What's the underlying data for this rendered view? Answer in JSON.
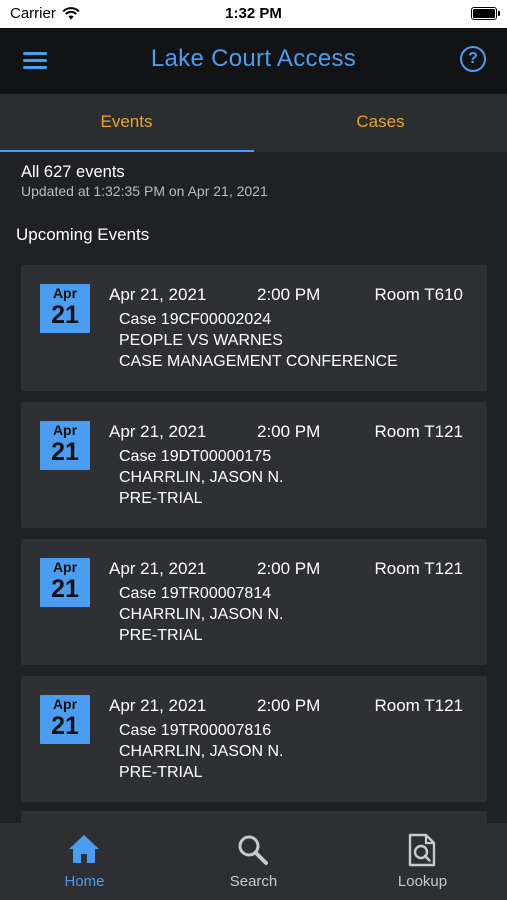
{
  "status_bar": {
    "carrier": "Carrier",
    "time": "1:32 PM"
  },
  "header": {
    "title": "Lake Court Access"
  },
  "tabs": [
    {
      "label": "Events",
      "selected": true
    },
    {
      "label": "Cases",
      "selected": false
    }
  ],
  "summary": {
    "count": "All 627 events",
    "updated": "Updated at 1:32:35 PM on Apr 21, 2021"
  },
  "section_title": "Upcoming Events",
  "events": [
    {
      "month": "Apr",
      "day": "21",
      "date": "Apr 21, 2021",
      "time": "2:00 PM",
      "room": "Room T610",
      "case": "Case 19CF00002024",
      "party": "PEOPLE VS WARNES",
      "type": "CASE MANAGEMENT CONFERENCE"
    },
    {
      "month": "Apr",
      "day": "21",
      "date": "Apr 21, 2021",
      "time": "2:00 PM",
      "room": "Room T121",
      "case": "Case 19DT00000175",
      "party": "CHARRLIN, JASON N.",
      "type": "PRE-TRIAL"
    },
    {
      "month": "Apr",
      "day": "21",
      "date": "Apr 21, 2021",
      "time": "2:00 PM",
      "room": "Room T121",
      "case": "Case 19TR00007814",
      "party": "CHARRLIN, JASON N.",
      "type": "PRE-TRIAL"
    },
    {
      "month": "Apr",
      "day": "21",
      "date": "Apr 21, 2021",
      "time": "2:00 PM",
      "room": "Room T121",
      "case": "Case 19TR00007816",
      "party": "CHARRLIN, JASON N.",
      "type": "PRE-TRIAL"
    }
  ],
  "bottom_nav": [
    {
      "label": "Home",
      "icon": "home-icon",
      "active": true
    },
    {
      "label": "Search",
      "icon": "search-icon",
      "active": false
    },
    {
      "label": "Lookup",
      "icon": "document-search-icon",
      "active": false
    }
  ],
  "colors": {
    "accent": "#4a9df0",
    "tab_text": "#e8a623",
    "background": "#1f2124",
    "card": "#2e3034"
  }
}
